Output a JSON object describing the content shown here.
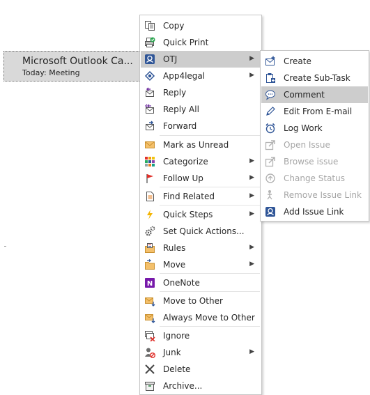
{
  "mail_item": {
    "title": "Microsoft Outlook Ca...",
    "subtitle": "Today: Meeting"
  },
  "context_menu": {
    "items": [
      {
        "label": "Copy",
        "icon": "copy-icon"
      },
      {
        "label": "Quick Print",
        "icon": "printer-icon"
      },
      {
        "label": "OTJ",
        "icon": "otj-icon",
        "submenu": true,
        "highlighted": true
      },
      {
        "label": "App4legal",
        "icon": "app4legal-icon",
        "submenu": true
      },
      {
        "label": "Reply",
        "icon": "reply-icon"
      },
      {
        "label": "Reply All",
        "icon": "reply-all-icon"
      },
      {
        "label": "Forward",
        "icon": "forward-icon"
      },
      {
        "label": "Mark as Unread",
        "icon": "envelope-icon"
      },
      {
        "label": "Categorize",
        "icon": "category-grid-icon",
        "submenu": true
      },
      {
        "label": "Follow Up",
        "icon": "flag-icon",
        "submenu": true
      },
      {
        "label": "Find Related",
        "icon": "document-icon",
        "submenu": true
      },
      {
        "label": "Quick Steps",
        "icon": "lightning-icon",
        "submenu": true
      },
      {
        "label": "Set Quick Actions...",
        "icon": "gears-icon"
      },
      {
        "label": "Rules",
        "icon": "rules-icon",
        "submenu": true
      },
      {
        "label": "Move",
        "icon": "move-folder-icon",
        "submenu": true
      },
      {
        "label": "OneNote",
        "icon": "onenote-icon"
      },
      {
        "label": "Move to Other",
        "icon": "move-to-other-icon"
      },
      {
        "label": "Always Move to Other",
        "icon": "always-move-icon"
      },
      {
        "label": "Ignore",
        "icon": "ignore-icon"
      },
      {
        "label": "Junk",
        "icon": "junk-icon",
        "submenu": true
      },
      {
        "label": "Delete",
        "icon": "delete-icon"
      },
      {
        "label": "Archive...",
        "icon": "archive-icon"
      }
    ]
  },
  "otj_submenu": {
    "items": [
      {
        "label": "Create",
        "icon": "envelope-plus-icon",
        "enabled": true
      },
      {
        "label": "Create Sub-Task",
        "icon": "clipboard-icon",
        "enabled": true
      },
      {
        "label": "Comment",
        "icon": "comment-bubble-icon",
        "enabled": true,
        "highlighted": true
      },
      {
        "label": "Edit From E-mail",
        "icon": "pencil-icon",
        "enabled": true
      },
      {
        "label": "Log Work",
        "icon": "alarm-clock-icon",
        "enabled": true
      },
      {
        "label": "Open Issue",
        "icon": "open-arrow-icon",
        "enabled": false
      },
      {
        "label": "Browse issue",
        "icon": "browse-arrow-icon",
        "enabled": false
      },
      {
        "label": "Change Status",
        "icon": "status-icon",
        "enabled": false
      },
      {
        "label": "Remove Issue Link",
        "icon": "unlink-icon",
        "enabled": false
      },
      {
        "label": "Add Issue Link",
        "icon": "add-link-icon",
        "enabled": true
      }
    ]
  },
  "colors": {
    "highlight": "#cdcdcd",
    "disabled_text": "#a6a6a6",
    "otj_blue": "#2f5597",
    "onenote_purple": "#7719aa",
    "flag_red": "#e0302a"
  }
}
